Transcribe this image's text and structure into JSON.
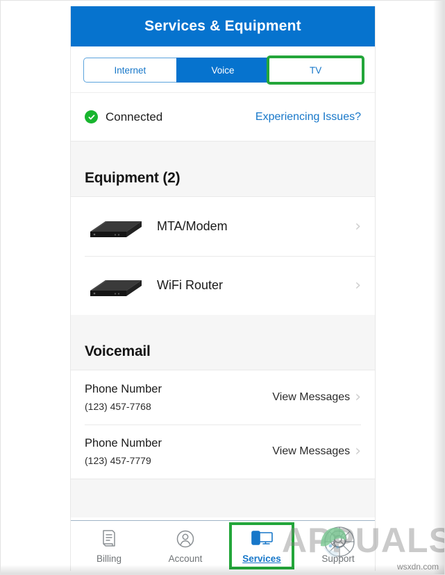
{
  "header": {
    "title": "Services & Equipment",
    "background_color": "#0673ce"
  },
  "segmented_control": {
    "tabs": [
      {
        "label": "Internet",
        "state": "inactive"
      },
      {
        "label": "Voice",
        "state": "selected"
      },
      {
        "label": "TV",
        "state": "highlighted"
      }
    ],
    "highlight_color": "#23a63a",
    "accent_color": "#1777c9"
  },
  "status": {
    "icon": "check-circle-icon",
    "text": "Connected",
    "status_color": "#18b52e",
    "link_label": "Experiencing Issues?",
    "link_color": "#1777c9"
  },
  "equipment": {
    "section_title": "Equipment (2)",
    "items": [
      {
        "name": "MTA/Modem",
        "icon": "modem-device-icon",
        "chevron": "›"
      },
      {
        "name": "WiFi Router",
        "icon": "router-device-icon",
        "chevron": "›"
      }
    ]
  },
  "voicemail": {
    "section_title": "Voicemail",
    "items": [
      {
        "label": "Phone Number",
        "number": "(123) 457-7768",
        "action": "View Messages",
        "chevron": "›"
      },
      {
        "label": "Phone Number",
        "number": "(123) 457-7779",
        "action": "View Messages",
        "chevron": "›"
      }
    ]
  },
  "bottom_nav": {
    "items": [
      {
        "label": "Billing",
        "icon": "invoice-document-icon",
        "active": false
      },
      {
        "label": "Account",
        "icon": "person-circle-icon",
        "active": false
      },
      {
        "label": "Services",
        "icon": "devices-icon",
        "active": true
      },
      {
        "label": "Support",
        "icon": "lifebuoy-icon",
        "active": false
      }
    ],
    "active_color": "#1777c9",
    "inactive_color": "#6f7376",
    "highlight_color": "#23a63a"
  },
  "watermark": {
    "text": "APPUALS",
    "site": "wsxdn.com"
  }
}
